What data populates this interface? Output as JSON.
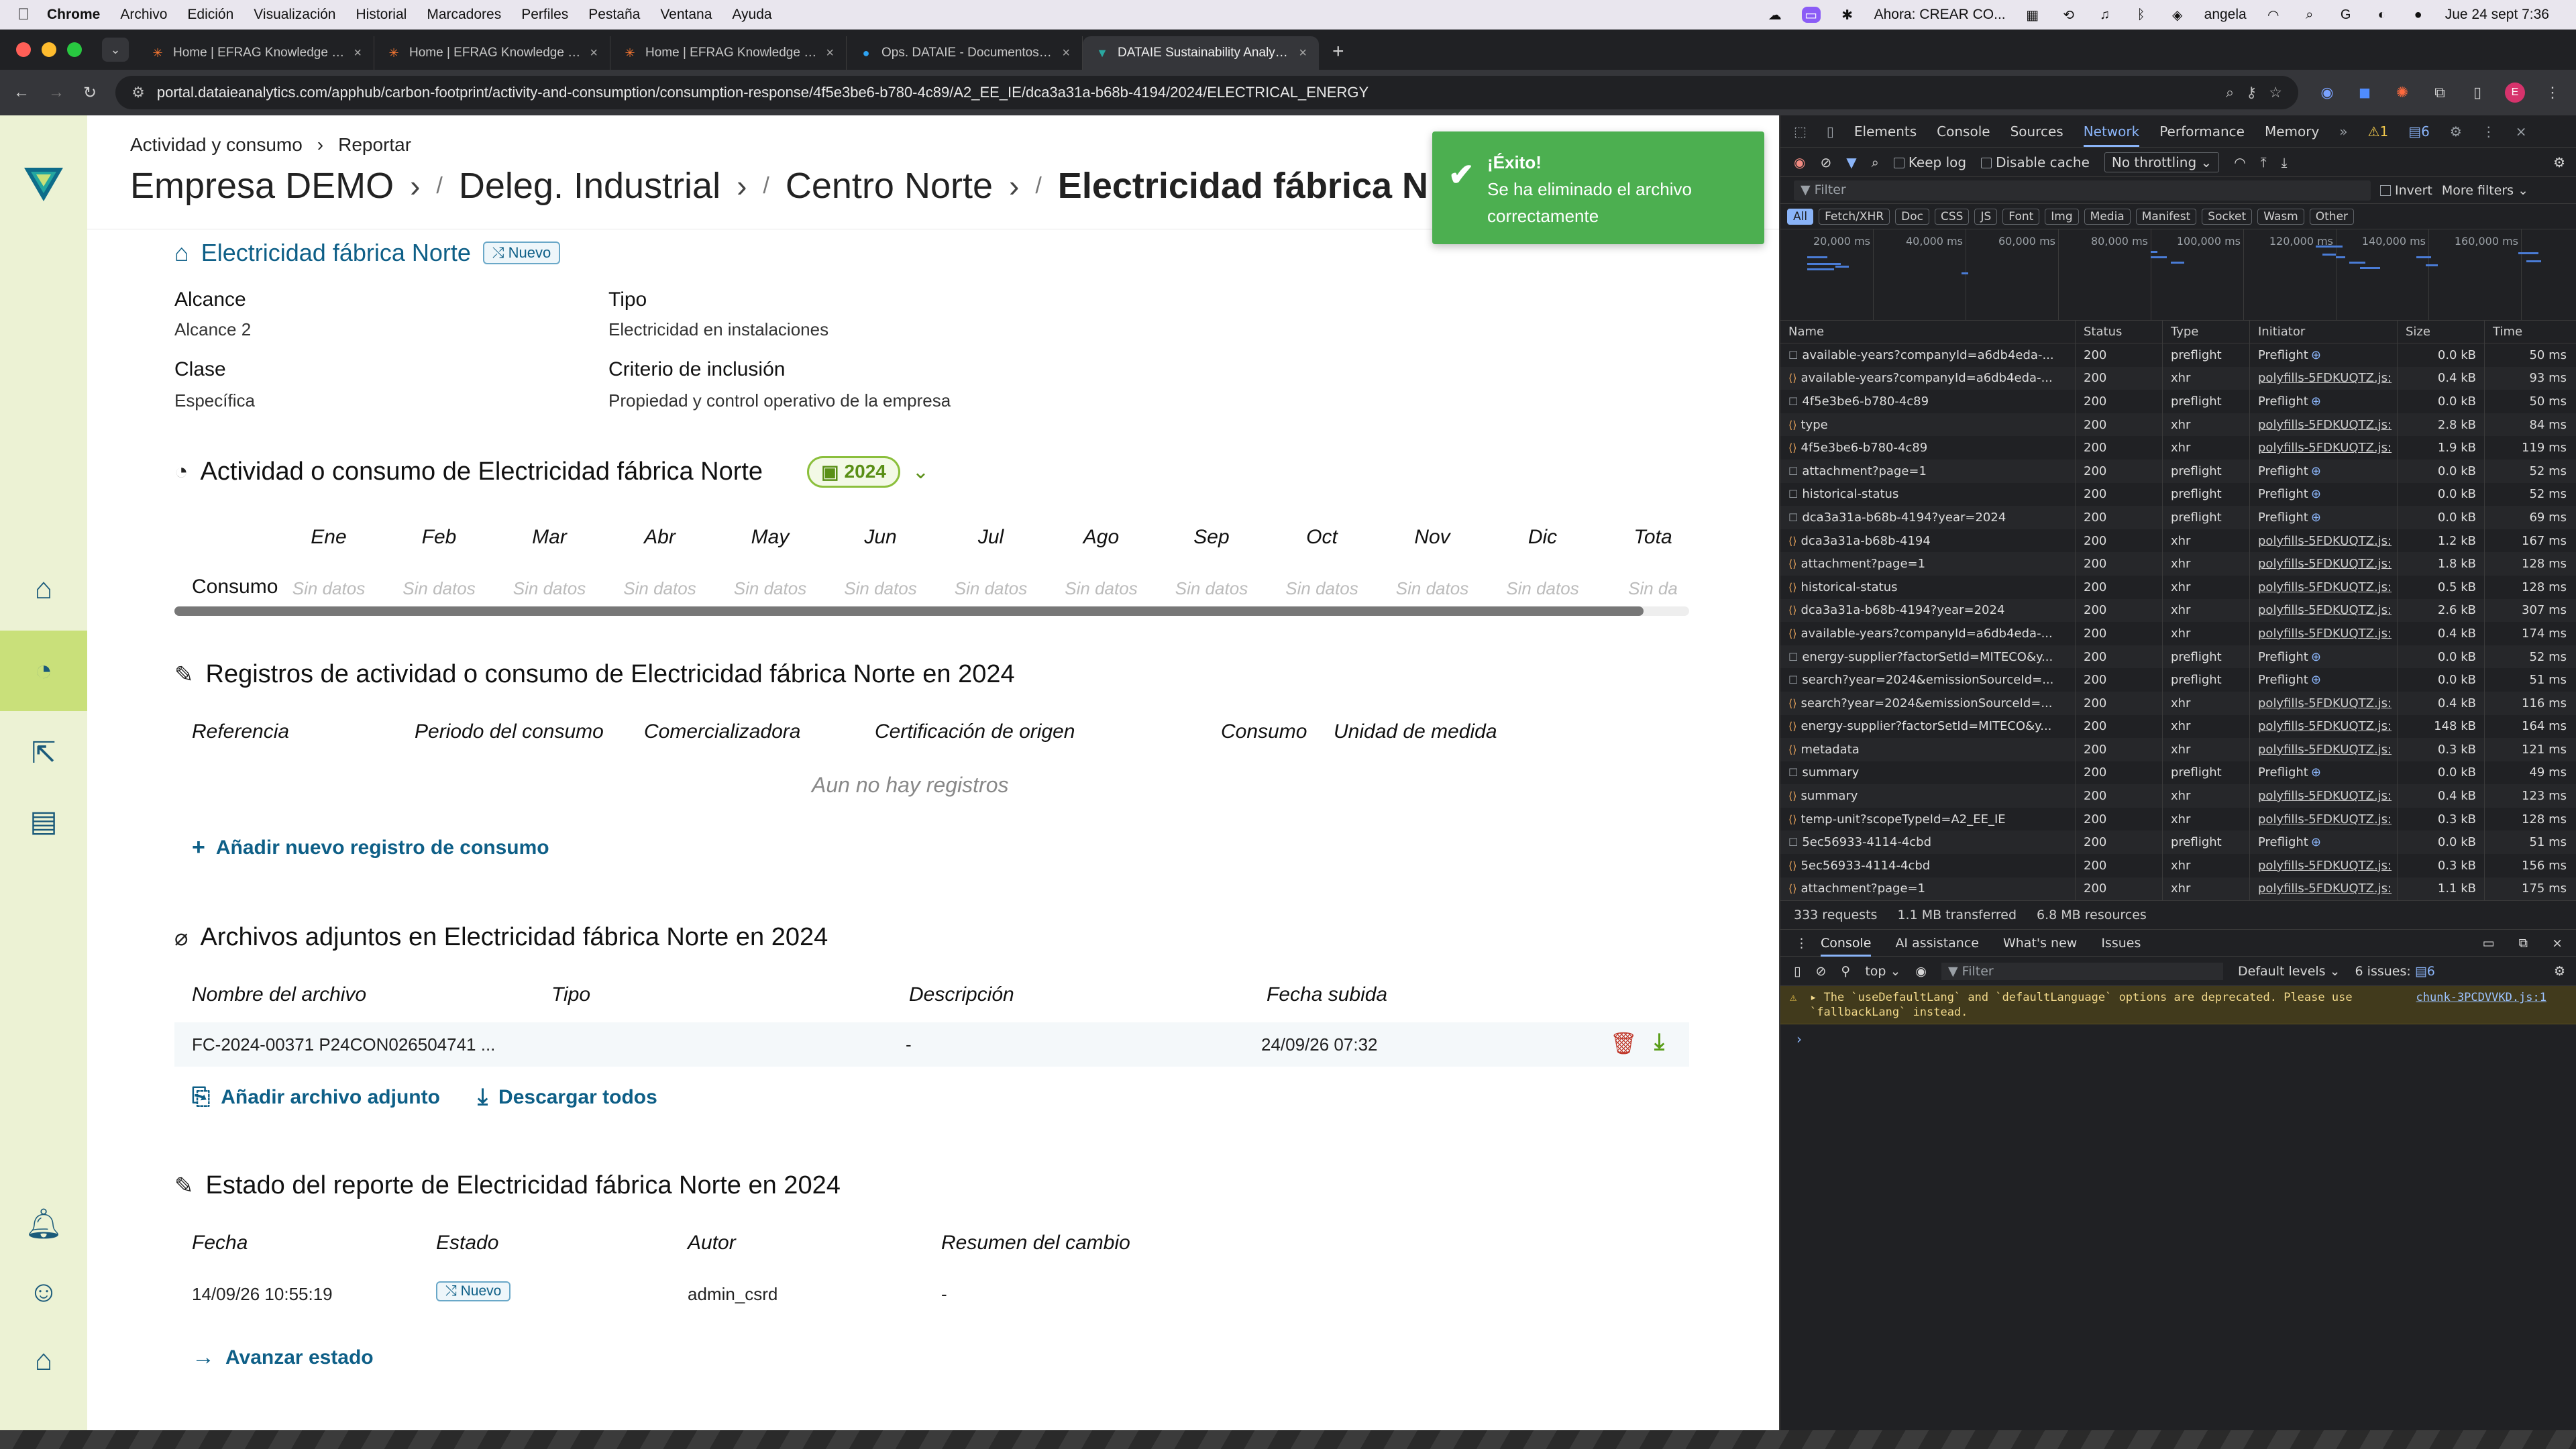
{
  "menubar": {
    "app": "Chrome",
    "items": [
      "Archivo",
      "Edición",
      "Visualización",
      "Historial",
      "Marcadores",
      "Perfiles",
      "Pestaña",
      "Ventana",
      "Ayuda"
    ],
    "now_playing": "Ahora: CREAR CO...",
    "user": "angela",
    "clock": "Jue 24 sept 7:36"
  },
  "tabs": [
    {
      "title": "Home | EFRAG Knowledge Hu...",
      "icon": "efrag-icon"
    },
    {
      "title": "Home | EFRAG Knowledge Hu...",
      "icon": "efrag-icon"
    },
    {
      "title": "Home | EFRAG Knowledge Hu...",
      "icon": "efrag-icon"
    },
    {
      "title": "Ops. DATAIE - Documentos -...",
      "icon": "sharepoint-icon"
    },
    {
      "title": "DATAIE Sustainability Analytic...",
      "icon": "dataie-icon",
      "active": true
    }
  ],
  "address": {
    "url": "portal.dataieanalytics.com/apphub/carbon-footprint/activity-and-consumption/consumption-response/4f5e3be6-b780-4c89/A2_EE_IE/dca3a31a-b68b-4194/2024/ELECTRICAL_ENERGY"
  },
  "header": {
    "crumb_small": [
      "Actividad y consumo",
      "Reportar"
    ],
    "crumb_big": [
      "Empresa DEMO",
      "Deleg. Industrial",
      "Centro Norte",
      "Electricidad fábrica N"
    ]
  },
  "toast": {
    "title": "¡Éxito!",
    "message_line1": "Se ha eliminado el archivo",
    "message_line2": "correctamente",
    "color": "#4caf50"
  },
  "source": {
    "title": "Electricidad fábrica Norte",
    "badge": "Nuevo",
    "fields": {
      "alcance_label": "Alcance",
      "alcance_value": "Alcance 2",
      "tipo_label": "Tipo",
      "tipo_value": "Electricidad en instalaciones",
      "clase_label": "Clase",
      "clase_value": "Específica",
      "criterio_label": "Criterio de inclusión",
      "criterio_value": "Propiedad y control operativo de la empresa"
    }
  },
  "activity": {
    "title": "Actividad o consumo de Electricidad fábrica Norte",
    "year": "2024",
    "row_label": "Consumo",
    "months": [
      "Ene",
      "Feb",
      "Mar",
      "Abr",
      "May",
      "Jun",
      "Jul",
      "Ago",
      "Sep",
      "Oct",
      "Nov",
      "Dic",
      "Tota"
    ],
    "values": [
      "Sin datos",
      "Sin datos",
      "Sin datos",
      "Sin datos",
      "Sin datos",
      "Sin datos",
      "Sin datos",
      "Sin datos",
      "Sin datos",
      "Sin datos",
      "Sin datos",
      "Sin datos",
      "Sin da"
    ]
  },
  "records": {
    "title": "Registros de actividad o consumo de Electricidad fábrica Norte en 2024",
    "columns": [
      "Referencia",
      "Periodo del consumo",
      "Comercializadora",
      "Certificación de origen",
      "Consumo",
      "Unidad de medida"
    ],
    "empty": "Aun no hay registros",
    "add_label": "Añadir nuevo registro de consumo"
  },
  "attachments": {
    "title": "Archivos adjuntos en Electricidad fábrica Norte en 2024",
    "columns": [
      "Nombre del archivo",
      "Tipo",
      "Descripción",
      "Fecha subida"
    ],
    "row": {
      "name": "FC-2024-00371 P24CON026504741 ...",
      "type": "",
      "description": "-",
      "date": "24/09/26 07:32"
    },
    "add_label": "Añadir archivo adjunto",
    "download_label": "Descargar todos"
  },
  "status": {
    "title": "Estado del reporte de Electricidad fábrica Norte en 2024",
    "columns": [
      "Fecha",
      "Estado",
      "Autor",
      "Resumen del cambio"
    ],
    "row": {
      "date": "14/09/26 10:55:19",
      "state": "Nuevo",
      "author": "admin_csrd",
      "summary": "-"
    },
    "advance_label": "Avanzar estado"
  },
  "devtools": {
    "tabs": [
      "Elements",
      "Console",
      "Sources",
      "Network",
      "Performance",
      "Memory"
    ],
    "active_tab": "Network",
    "warnings": "1",
    "messages": "6",
    "keep_log": "Keep log",
    "disable_cache": "Disable cache",
    "throttling": "No throttling",
    "filter_placeholder": "Filter",
    "invert": "Invert",
    "more_filters": "More filters",
    "chips": [
      "All",
      "Fetch/XHR",
      "Doc",
      "CSS",
      "JS",
      "Font",
      "Img",
      "Media",
      "Manifest",
      "Socket",
      "Wasm",
      "Other"
    ],
    "ticks": [
      "20,000 ms",
      "40,000 ms",
      "60,000 ms",
      "80,000 ms",
      "100,000 ms",
      "120,000 ms",
      "140,000 ms",
      "160,000 ms",
      "180"
    ],
    "columns": [
      "Name",
      "Status",
      "Type",
      "Initiator",
      "Size",
      "Time"
    ],
    "rows": [
      [
        "available-years?companyId=a6db4eda-...",
        "200",
        "preflight",
        "Preflight",
        "0.0 kB",
        "50 ms"
      ],
      [
        "available-years?companyId=a6db4eda-...",
        "200",
        "xhr",
        "polyfills-5FDKUQTZ.js:",
        "0.4 kB",
        "93 ms"
      ],
      [
        "4f5e3be6-b780-4c89",
        "200",
        "preflight",
        "Preflight",
        "0.0 kB",
        "50 ms"
      ],
      [
        "type",
        "200",
        "xhr",
        "polyfills-5FDKUQTZ.js:",
        "2.8 kB",
        "84 ms"
      ],
      [
        "4f5e3be6-b780-4c89",
        "200",
        "xhr",
        "polyfills-5FDKUQTZ.js:",
        "1.9 kB",
        "119 ms"
      ],
      [
        "attachment?page=1",
        "200",
        "preflight",
        "Preflight",
        "0.0 kB",
        "52 ms"
      ],
      [
        "historical-status",
        "200",
        "preflight",
        "Preflight",
        "0.0 kB",
        "52 ms"
      ],
      [
        "dca3a31a-b68b-4194?year=2024",
        "200",
        "preflight",
        "Preflight",
        "0.0 kB",
        "69 ms"
      ],
      [
        "dca3a31a-b68b-4194",
        "200",
        "xhr",
        "polyfills-5FDKUQTZ.js:",
        "1.2 kB",
        "167 ms"
      ],
      [
        "attachment?page=1",
        "200",
        "xhr",
        "polyfills-5FDKUQTZ.js:",
        "1.8 kB",
        "128 ms"
      ],
      [
        "historical-status",
        "200",
        "xhr",
        "polyfills-5FDKUQTZ.js:",
        "0.5 kB",
        "128 ms"
      ],
      [
        "dca3a31a-b68b-4194?year=2024",
        "200",
        "xhr",
        "polyfills-5FDKUQTZ.js:",
        "2.6 kB",
        "307 ms"
      ],
      [
        "available-years?companyId=a6db4eda-...",
        "200",
        "xhr",
        "polyfills-5FDKUQTZ.js:",
        "0.4 kB",
        "174 ms"
      ],
      [
        "energy-supplier?factorSetId=MITECO&y...",
        "200",
        "preflight",
        "Preflight",
        "0.0 kB",
        "52 ms"
      ],
      [
        "search?year=2024&emissionSourceId=...",
        "200",
        "preflight",
        "Preflight",
        "0.0 kB",
        "51 ms"
      ],
      [
        "search?year=2024&emissionSourceId=...",
        "200",
        "xhr",
        "polyfills-5FDKUQTZ.js:",
        "0.4 kB",
        "116 ms"
      ],
      [
        "energy-supplier?factorSetId=MITECO&y...",
        "200",
        "xhr",
        "polyfills-5FDKUQTZ.js:",
        "148 kB",
        "164 ms"
      ],
      [
        "metadata",
        "200",
        "xhr",
        "polyfills-5FDKUQTZ.js:",
        "0.3 kB",
        "121 ms"
      ],
      [
        "summary",
        "200",
        "preflight",
        "Preflight",
        "0.0 kB",
        "49 ms"
      ],
      [
        "summary",
        "200",
        "xhr",
        "polyfills-5FDKUQTZ.js:",
        "0.4 kB",
        "123 ms"
      ],
      [
        "temp-unit?scopeTypeId=A2_EE_IE",
        "200",
        "xhr",
        "polyfills-5FDKUQTZ.js:",
        "0.3 kB",
        "128 ms"
      ],
      [
        "5ec56933-4114-4cbd",
        "200",
        "preflight",
        "Preflight",
        "0.0 kB",
        "51 ms"
      ],
      [
        "5ec56933-4114-4cbd",
        "200",
        "xhr",
        "polyfills-5FDKUQTZ.js:",
        "0.3 kB",
        "156 ms"
      ],
      [
        "attachment?page=1",
        "200",
        "xhr",
        "polyfills-5FDKUQTZ.js:",
        "1.1 kB",
        "175 ms"
      ]
    ],
    "summary": {
      "requests": "333 requests",
      "transferred": "1.1 MB transferred",
      "resources": "6.8 MB resources"
    },
    "drawer_tabs": [
      "Console",
      "AI assistance",
      "What's new",
      "Issues"
    ],
    "console": {
      "context": "top",
      "filter": "Filter",
      "levels": "Default levels",
      "issues": "6 issues:",
      "issues_count": "6"
    },
    "warning_line1": "▸ The `useDefaultLang` and `defaultLanguage` options are deprecated. Please use",
    "warning_line2": "`fallbackLang` instead.",
    "warning_source": "chunk-3PCDVVKD.js:1"
  }
}
